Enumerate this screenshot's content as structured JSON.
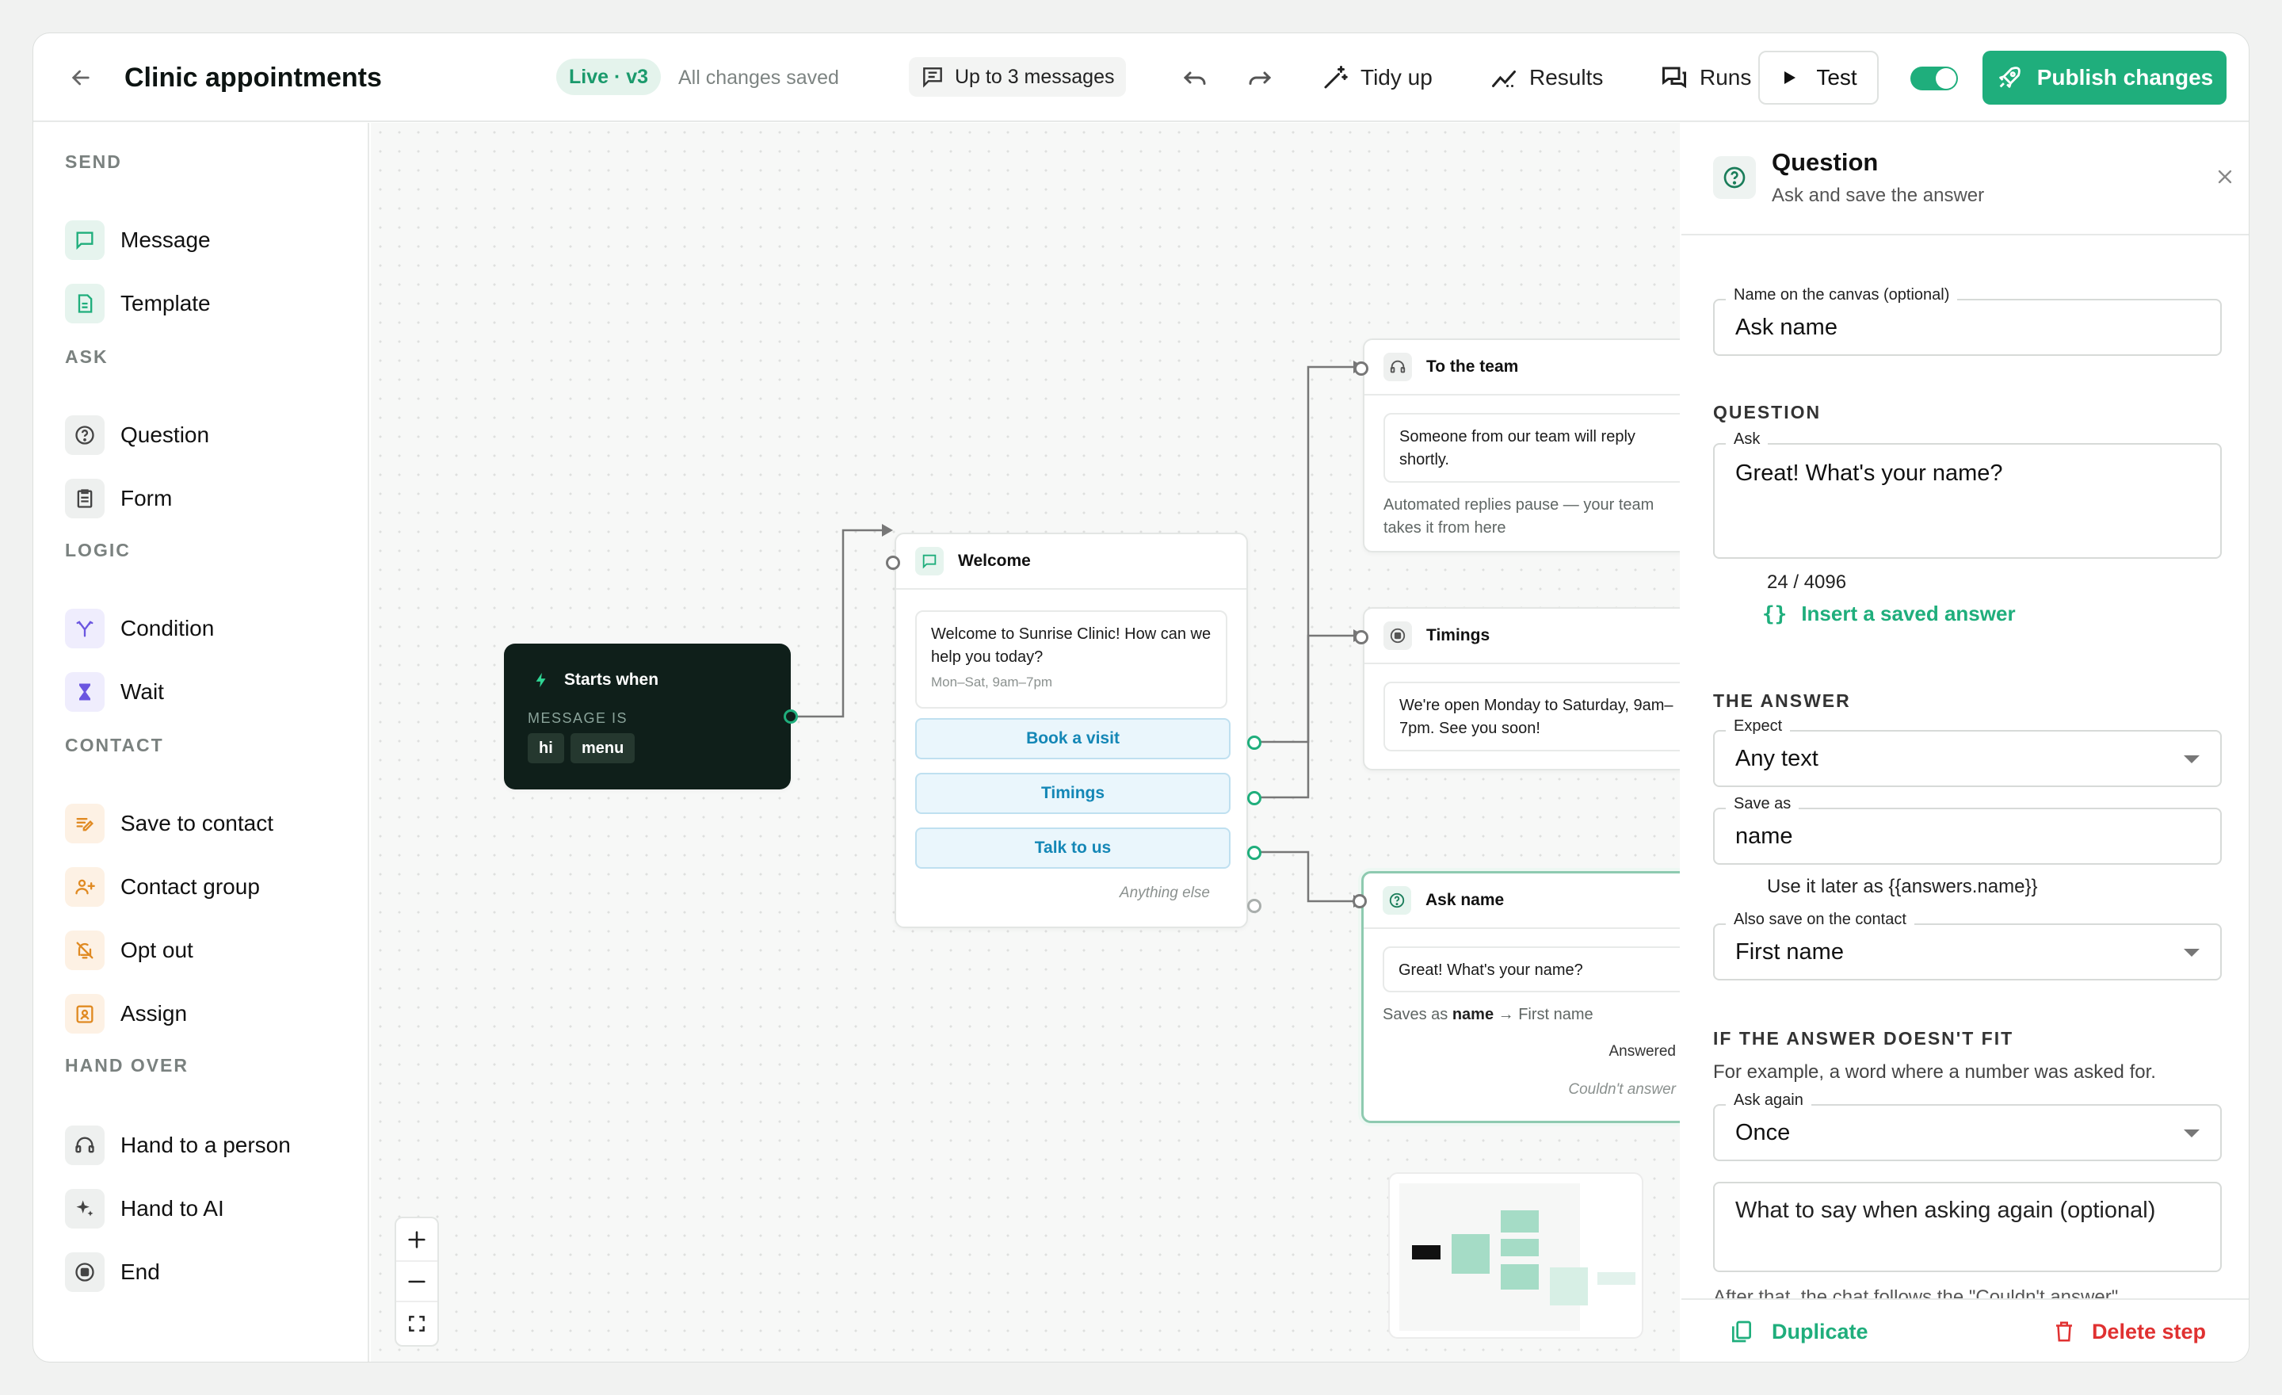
{
  "header": {
    "title": "Clinic appointments",
    "live_badge": "Live · v3",
    "save_status": "All changes saved",
    "message_limit": "Up to 3 messages",
    "tidy_label": "Tidy up",
    "results_label": "Results",
    "runs_label": "Runs",
    "test_label": "Test",
    "publish_label": "Publish changes"
  },
  "sidebar": {
    "sections": [
      {
        "title": "SEND",
        "items": [
          {
            "label": "Message",
            "icon": "message-icon"
          },
          {
            "label": "Template",
            "icon": "template-icon"
          }
        ]
      },
      {
        "title": "ASK",
        "items": [
          {
            "label": "Question",
            "icon": "question-icon"
          },
          {
            "label": "Form",
            "icon": "form-icon"
          }
        ]
      },
      {
        "title": "LOGIC",
        "items": [
          {
            "label": "Condition",
            "icon": "branch-icon"
          },
          {
            "label": "Wait",
            "icon": "hourglass-icon"
          }
        ]
      },
      {
        "title": "CONTACT",
        "items": [
          {
            "label": "Save to contact",
            "icon": "edit-list-icon"
          },
          {
            "label": "Contact group",
            "icon": "users-plus-icon"
          },
          {
            "label": "Opt out",
            "icon": "bell-off-icon"
          },
          {
            "label": "Assign",
            "icon": "badge-icon"
          }
        ]
      },
      {
        "title": "HAND OVER",
        "items": [
          {
            "label": "Hand to a person",
            "icon": "headset-icon"
          },
          {
            "label": "Hand to AI",
            "icon": "sparkles-icon"
          },
          {
            "label": "End",
            "icon": "stop-icon"
          }
        ]
      }
    ]
  },
  "canvas": {
    "trigger": {
      "title": "Starts when",
      "condition_label": "MESSAGE IS",
      "keywords": [
        "hi",
        "menu"
      ]
    },
    "welcome": {
      "title": "Welcome",
      "message": "Welcome to Sunrise Clinic! How can we help you today?",
      "footer": "Mon–Sat, 9am–7pm",
      "buttons": [
        "Book a visit",
        "Timings",
        "Talk to us"
      ],
      "fallback": "Anything else"
    },
    "team": {
      "title": "To the team",
      "message": "Someone from our team will reply shortly.",
      "note": "Automated replies pause — your team takes it from here"
    },
    "timings": {
      "title": "Timings",
      "message": "We're open Monday to Saturday, 9am–7pm. See you soon!"
    },
    "ask": {
      "title": "Ask name",
      "question": "Great! What's your name?",
      "saves_prefix": "Saves as ",
      "saves_var": "name",
      "saves_suffix": " → First name",
      "answered": "Answered",
      "failed": "Couldn't answer"
    }
  },
  "panel": {
    "title": "Question",
    "subtitle": "Ask and save the answer",
    "name_label": "Name on the canvas (optional)",
    "name_value": "Ask name",
    "question_section": "QUESTION",
    "ask_label": "Ask",
    "ask_value": "Great! What's your name?",
    "char_count": "24 / 4096",
    "insert_label": "Insert a saved answer",
    "answer_section": "THE ANSWER",
    "expect_label": "Expect",
    "expect_value": "Any text",
    "save_as_label": "Save as",
    "save_as_value": "name",
    "use_later": "Use it later as {{answers.name}}",
    "contact_label": "Also save on the contact",
    "contact_value": "First name",
    "fit_section": "IF THE ANSWER DOESN'T FIT",
    "fit_example": "For example, a word where a number was asked for.",
    "ask_again_label": "Ask again",
    "ask_again_value": "Once",
    "retry_placeholder": "What to say when asking again (optional)",
    "cut_text": "After that, the chat follows the \"Couldn't answer\"",
    "duplicate_label": "Duplicate",
    "delete_label": "Delete step"
  },
  "colors": {
    "accent": "#1fae7c",
    "danger": "#e03131",
    "trigger": "#0f1f1a",
    "quick_reply": "#1487b6"
  }
}
